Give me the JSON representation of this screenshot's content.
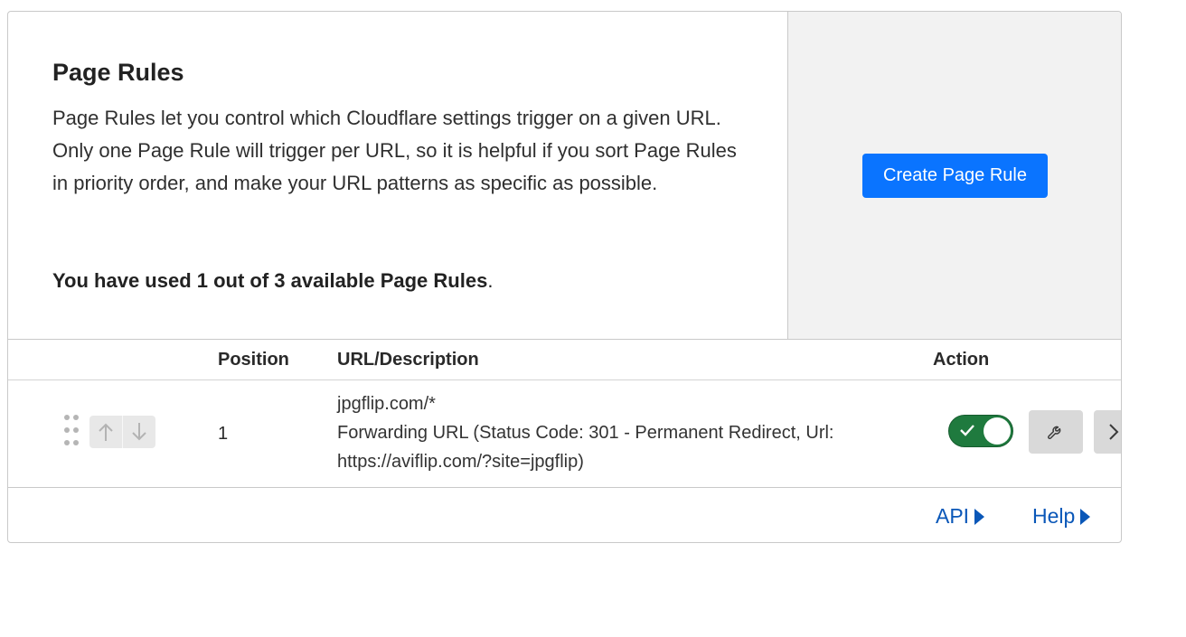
{
  "intro": {
    "title": "Page Rules",
    "description": "Page Rules let you control which Cloudflare settings trigger on a given URL. Only one Page Rule will trigger per URL, so it is helpful if you sort Page Rules in priority order, and make your URL patterns as specific as possible.",
    "usage_bold": "You have used 1 out of 3 available Page Rules",
    "usage_suffix": "."
  },
  "cta": {
    "create_label": "Create Page Rule",
    "color": "#0a74ff"
  },
  "table": {
    "headers": {
      "position": "Position",
      "url": "URL/Description",
      "action": "Action"
    },
    "rows": [
      {
        "position": "1",
        "url": "jpgflip.com/*",
        "description_line1": "Forwarding URL (Status Code: 301 - Permanent Redirect, Url:",
        "description_line2": "https://aviflip.com/?site=jpgflip)",
        "enabled": true
      }
    ]
  },
  "footer": {
    "api_label": "API",
    "help_label": "Help"
  },
  "colors": {
    "toggle_on": "#1f7a3e",
    "link": "#0a57b8",
    "panel_bg": "#f2f2f2"
  },
  "icons": [
    "drag-handle-icon",
    "arrow-up-icon",
    "arrow-down-icon",
    "check-icon",
    "wrench-icon",
    "chevron-right-icon",
    "caret-right-icon"
  ]
}
